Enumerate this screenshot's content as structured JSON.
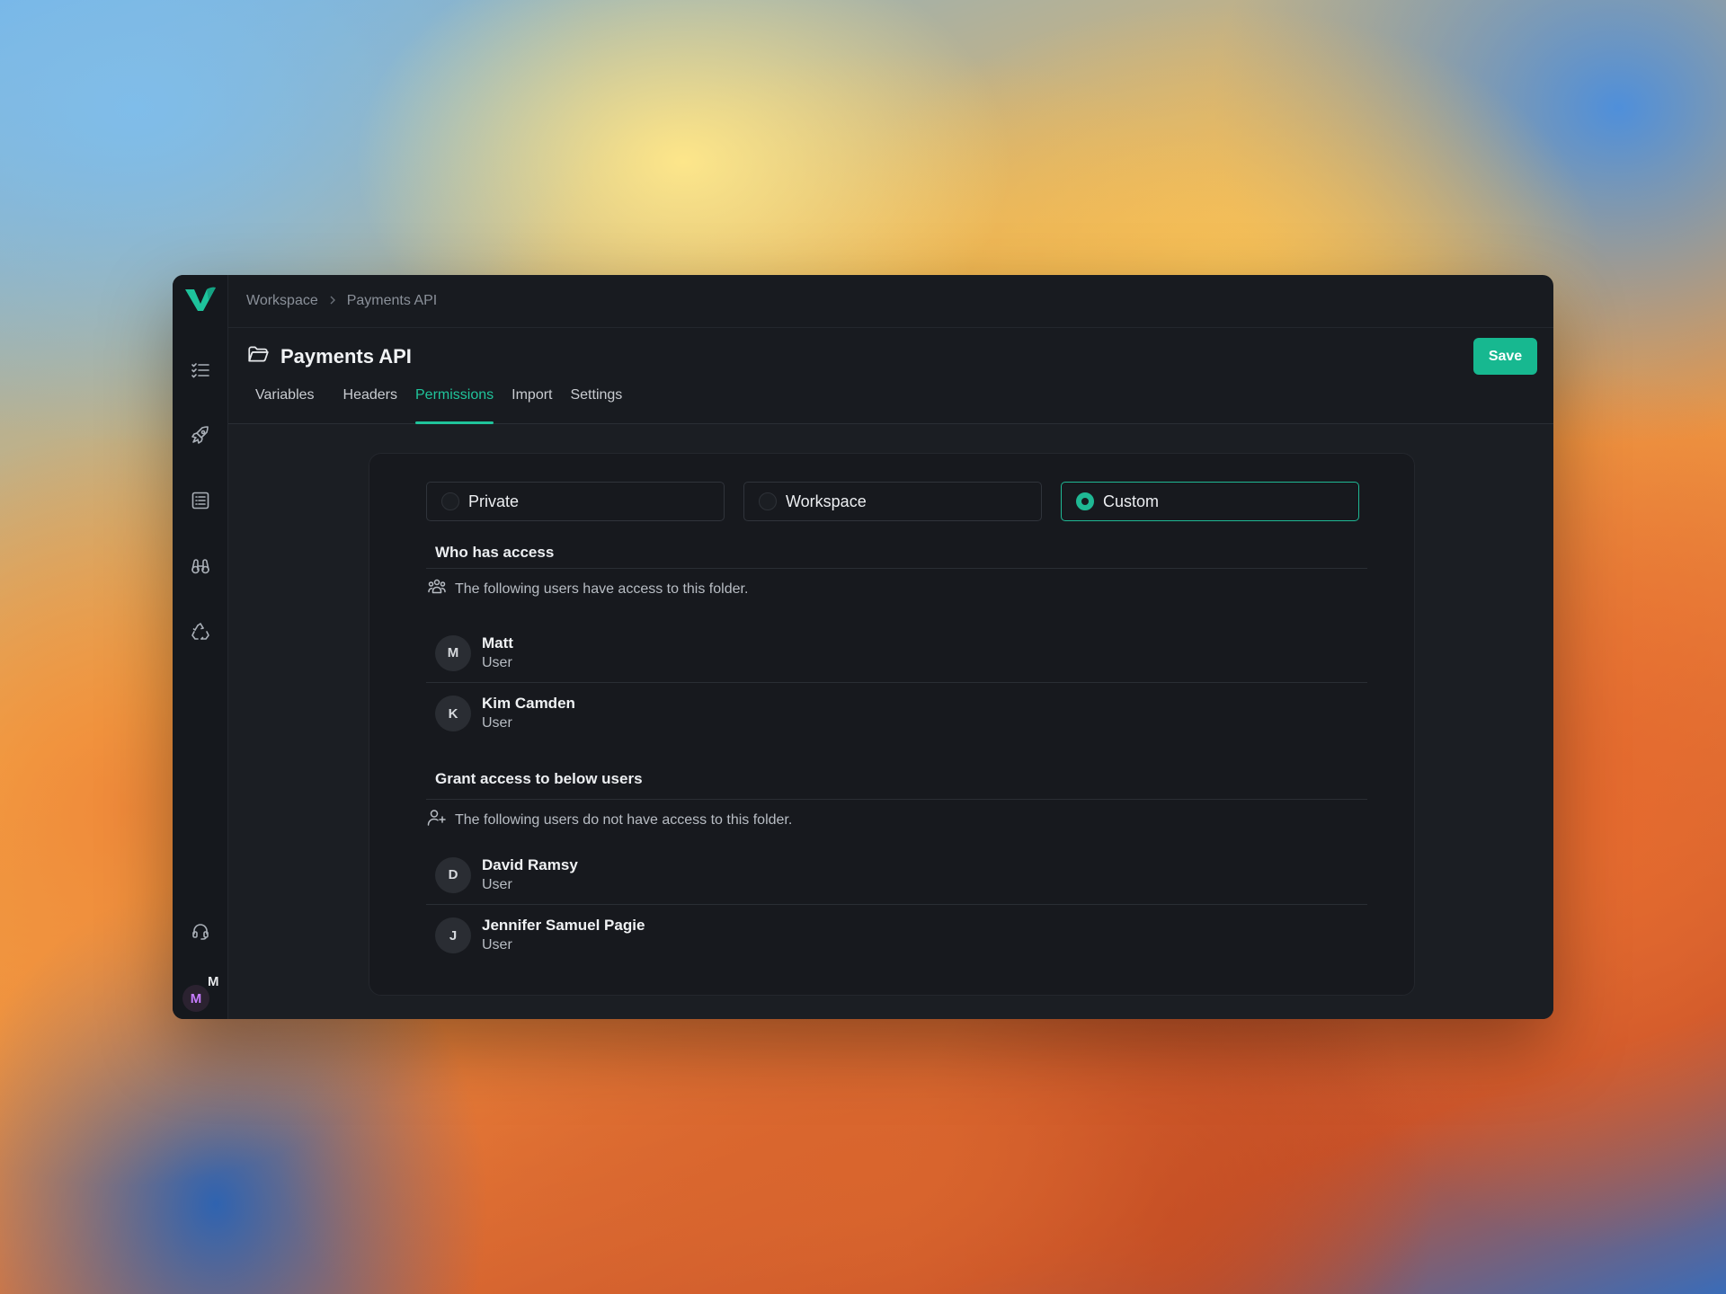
{
  "breadcrumb": {
    "root": "Workspace",
    "current": "Payments API"
  },
  "header": {
    "title": "Payments API",
    "save_label": "Save"
  },
  "tabs": [
    {
      "label": "Variables",
      "active": false
    },
    {
      "label": "Headers",
      "active": false
    },
    {
      "label": "Permissions",
      "active": true
    },
    {
      "label": "Import",
      "active": false
    },
    {
      "label": "Settings",
      "active": false
    }
  ],
  "visibility": {
    "options": [
      "Private",
      "Workspace",
      "Custom"
    ],
    "selected": "Custom"
  },
  "access": {
    "title": "Who has access",
    "description": "The following users have access to this folder.",
    "users": [
      {
        "initial": "M",
        "name": "Matt",
        "role": "User"
      },
      {
        "initial": "K",
        "name": "Kim Camden",
        "role": "User"
      }
    ]
  },
  "grant": {
    "title": "Grant access to below users",
    "description": "The following users do not have access to this folder.",
    "users": [
      {
        "initial": "D",
        "name": "David Ramsy",
        "role": "User"
      },
      {
        "initial": "J",
        "name": "Jennifer Samuel Pagie",
        "role": "User"
      }
    ]
  },
  "current_user": {
    "initial": "M",
    "badge": "M"
  },
  "colors": {
    "accent": "#17b890",
    "background": "#181b20",
    "avatar_accent": "#c77dff"
  },
  "sidebar_icons": [
    "checklist-icon",
    "rocket-icon",
    "list-box-icon",
    "binoculars-icon",
    "recycle-icon",
    "headset-icon"
  ]
}
